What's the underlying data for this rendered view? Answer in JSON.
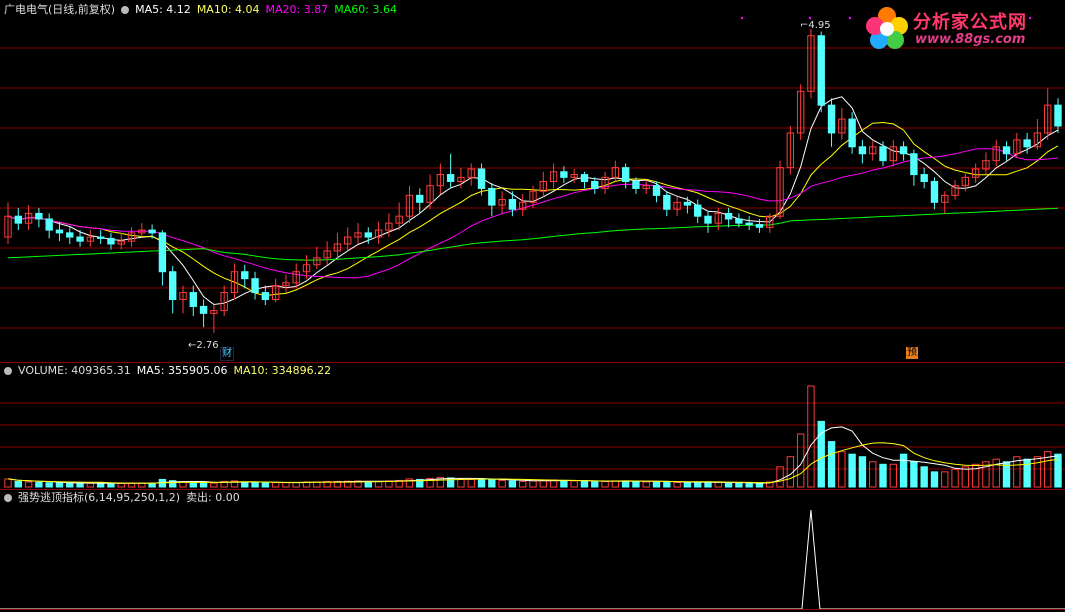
{
  "price_panel": {
    "title": "广电电气(日线,前复权)",
    "ma5": "MA5: 4.12",
    "ma10": "MA10: 4.04",
    "ma20": "MA20: 3.87",
    "ma60": "MA60: 3.64",
    "high_label": "4.95",
    "low_label": "2.76",
    "badge_cai": "财",
    "badge_yu": "预"
  },
  "volume_panel": {
    "volume": "VOLUME: 409365.31",
    "ma5": "MA5: 355905.06",
    "ma10": "MA10: 334896.22"
  },
  "indicator_panel": {
    "name": "强势逃顶指标(6,14,95,250,1,2)",
    "value": "卖出: 0.00"
  },
  "logo": {
    "text": "分析家公式网",
    "url": "www.88gs.com"
  },
  "colors": {
    "up": "#ff3b3b",
    "down": "#54ffff",
    "ma5": "#ffffff",
    "ma10": "#ffff00",
    "ma20": "#ff00ff",
    "ma60": "#00ff00",
    "grid": "#8b0000"
  },
  "chart_data": [
    {
      "type": "candlestick",
      "title": "广电电气(日线,前复权)",
      "y_marks": {
        "high": 4.95,
        "low": 2.76
      },
      "candles": [
        [
          3.45,
          3.6,
          3.7,
          3.4
        ],
        [
          3.6,
          3.55,
          3.66,
          3.5
        ],
        [
          3.55,
          3.62,
          3.68,
          3.5
        ],
        [
          3.62,
          3.58,
          3.66,
          3.52
        ],
        [
          3.58,
          3.5,
          3.62,
          3.44
        ],
        [
          3.5,
          3.48,
          3.56,
          3.42
        ],
        [
          3.48,
          3.45,
          3.52,
          3.4
        ],
        [
          3.45,
          3.42,
          3.5,
          3.38
        ],
        [
          3.42,
          3.45,
          3.5,
          3.38
        ],
        [
          3.45,
          3.44,
          3.5,
          3.4
        ],
        [
          3.44,
          3.4,
          3.48,
          3.36
        ],
        [
          3.4,
          3.42,
          3.48,
          3.36
        ],
        [
          3.42,
          3.48,
          3.52,
          3.38
        ],
        [
          3.48,
          3.5,
          3.55,
          3.45
        ],
        [
          3.5,
          3.48,
          3.54,
          3.44
        ],
        [
          3.48,
          3.2,
          3.5,
          3.1
        ],
        [
          3.2,
          3.0,
          3.24,
          2.9
        ],
        [
          3.0,
          3.05,
          3.1,
          2.9
        ],
        [
          3.05,
          2.95,
          3.1,
          2.88
        ],
        [
          2.95,
          2.9,
          3.0,
          2.8
        ],
        [
          2.9,
          2.92,
          2.96,
          2.76
        ],
        [
          2.92,
          3.05,
          3.1,
          2.88
        ],
        [
          3.05,
          3.2,
          3.26,
          3.0
        ],
        [
          3.2,
          3.15,
          3.25,
          3.08
        ],
        [
          3.15,
          3.05,
          3.2,
          3.0
        ],
        [
          3.05,
          3.0,
          3.1,
          2.96
        ],
        [
          3.0,
          3.1,
          3.15,
          2.98
        ],
        [
          3.1,
          3.12,
          3.18,
          3.05
        ],
        [
          3.12,
          3.2,
          3.26,
          3.08
        ],
        [
          3.2,
          3.25,
          3.32,
          3.15
        ],
        [
          3.25,
          3.3,
          3.38,
          3.22
        ],
        [
          3.3,
          3.35,
          3.42,
          3.25
        ],
        [
          3.35,
          3.4,
          3.48,
          3.3
        ],
        [
          3.4,
          3.45,
          3.52,
          3.35
        ],
        [
          3.45,
          3.48,
          3.55,
          3.4
        ],
        [
          3.48,
          3.45,
          3.52,
          3.4
        ],
        [
          3.45,
          3.5,
          3.56,
          3.4
        ],
        [
          3.5,
          3.55,
          3.62,
          3.45
        ],
        [
          3.55,
          3.6,
          3.7,
          3.5
        ],
        [
          3.6,
          3.75,
          3.82,
          3.55
        ],
        [
          3.75,
          3.7,
          3.8,
          3.62
        ],
        [
          3.7,
          3.82,
          3.9,
          3.65
        ],
        [
          3.82,
          3.9,
          3.98,
          3.76
        ],
        [
          3.9,
          3.85,
          4.05,
          3.8
        ],
        [
          3.85,
          3.88,
          3.95,
          3.8
        ],
        [
          3.88,
          3.94,
          3.98,
          3.82
        ],
        [
          3.94,
          3.8,
          3.98,
          3.75
        ],
        [
          3.8,
          3.68,
          3.84,
          3.6
        ],
        [
          3.68,
          3.72,
          3.78,
          3.62
        ],
        [
          3.72,
          3.65,
          3.78,
          3.6
        ],
        [
          3.65,
          3.7,
          3.76,
          3.6
        ],
        [
          3.7,
          3.78,
          3.82,
          3.66
        ],
        [
          3.78,
          3.85,
          3.92,
          3.74
        ],
        [
          3.85,
          3.92,
          3.98,
          3.8
        ],
        [
          3.92,
          3.88,
          3.96,
          3.84
        ],
        [
          3.88,
          3.9,
          3.94,
          3.84
        ],
        [
          3.9,
          3.85,
          3.92,
          3.8
        ],
        [
          3.85,
          3.8,
          3.88,
          3.76
        ],
        [
          3.8,
          3.88,
          3.92,
          3.76
        ],
        [
          3.88,
          3.95,
          4.0,
          3.85
        ],
        [
          3.95,
          3.85,
          3.98,
          3.8
        ],
        [
          3.85,
          3.8,
          3.88,
          3.76
        ],
        [
          3.8,
          3.82,
          3.86,
          3.76
        ],
        [
          3.82,
          3.75,
          3.85,
          3.7
        ],
        [
          3.75,
          3.65,
          3.78,
          3.6
        ],
        [
          3.65,
          3.7,
          3.74,
          3.6
        ],
        [
          3.7,
          3.68,
          3.74,
          3.62
        ],
        [
          3.68,
          3.6,
          3.72,
          3.55
        ],
        [
          3.6,
          3.55,
          3.64,
          3.48
        ],
        [
          3.55,
          3.62,
          3.66,
          3.5
        ],
        [
          3.62,
          3.58,
          3.66,
          3.52
        ],
        [
          3.58,
          3.55,
          3.62,
          3.52
        ],
        [
          3.55,
          3.54,
          3.6,
          3.5
        ],
        [
          3.54,
          3.52,
          3.58,
          3.48
        ],
        [
          3.52,
          3.6,
          3.62,
          3.48
        ],
        [
          3.6,
          3.95,
          4.0,
          3.58
        ],
        [
          3.95,
          4.2,
          4.25,
          3.9
        ],
        [
          4.2,
          4.5,
          4.55,
          4.15
        ],
        [
          4.5,
          4.9,
          4.95,
          4.45
        ],
        [
          4.9,
          4.4,
          4.93,
          4.35
        ],
        [
          4.4,
          4.2,
          4.45,
          4.1
        ],
        [
          4.2,
          4.3,
          4.38,
          4.15
        ],
        [
          4.3,
          4.1,
          4.35,
          4.05
        ],
        [
          4.1,
          4.05,
          4.15,
          3.98
        ],
        [
          4.05,
          4.1,
          4.14,
          4.0
        ],
        [
          4.1,
          4.0,
          4.14,
          3.96
        ],
        [
          4.0,
          4.1,
          4.15,
          3.96
        ],
        [
          4.1,
          4.05,
          4.14,
          4.0
        ],
        [
          4.05,
          3.9,
          4.08,
          3.82
        ],
        [
          3.9,
          3.85,
          3.95,
          3.8
        ],
        [
          3.85,
          3.7,
          3.88,
          3.65
        ],
        [
          3.7,
          3.75,
          3.78,
          3.62
        ],
        [
          3.75,
          3.82,
          3.86,
          3.72
        ],
        [
          3.82,
          3.88,
          3.92,
          3.78
        ],
        [
          3.88,
          3.94,
          3.98,
          3.84
        ],
        [
          3.94,
          4.0,
          4.06,
          3.9
        ],
        [
          4.0,
          4.1,
          4.15,
          3.96
        ],
        [
          4.1,
          4.05,
          4.14,
          4.0
        ],
        [
          4.05,
          4.15,
          4.2,
          4.02
        ],
        [
          4.15,
          4.1,
          4.2,
          4.05
        ],
        [
          4.1,
          4.2,
          4.3,
          4.08
        ],
        [
          4.2,
          4.4,
          4.52,
          4.15
        ],
        [
          4.4,
          4.25,
          4.45,
          4.2
        ]
      ],
      "ma": {
        "ma5": 4.12,
        "ma10": 4.04,
        "ma20": 3.87,
        "ma60": 3.64
      }
    },
    {
      "type": "bar",
      "title": "VOLUME",
      "volumes": [
        0.32,
        0.22,
        0.2,
        0.18,
        0.17,
        0.16,
        0.15,
        0.14,
        0.15,
        0.16,
        0.15,
        0.14,
        0.15,
        0.16,
        0.15,
        0.3,
        0.25,
        0.2,
        0.18,
        0.16,
        0.15,
        0.22,
        0.24,
        0.2,
        0.18,
        0.16,
        0.18,
        0.17,
        0.18,
        0.2,
        0.2,
        0.22,
        0.22,
        0.23,
        0.24,
        0.22,
        0.22,
        0.24,
        0.26,
        0.32,
        0.3,
        0.34,
        0.38,
        0.36,
        0.32,
        0.3,
        0.32,
        0.28,
        0.26,
        0.24,
        0.22,
        0.24,
        0.26,
        0.28,
        0.26,
        0.24,
        0.22,
        0.2,
        0.22,
        0.24,
        0.24,
        0.22,
        0.2,
        0.22,
        0.22,
        0.18,
        0.16,
        0.2,
        0.2,
        0.18,
        0.16,
        0.15,
        0.14,
        0.14,
        0.2,
        0.8,
        1.2,
        2.1,
        4.0,
        2.6,
        1.8,
        1.4,
        1.3,
        1.2,
        1.0,
        0.9,
        0.9,
        1.3,
        1.0,
        0.8,
        0.6,
        0.6,
        0.7,
        0.8,
        0.9,
        1.0,
        1.1,
        1.0,
        1.2,
        1.1,
        1.2,
        1.4,
        1.3
      ],
      "ma": {
        "ma5": 355905.06,
        "ma10": 334896.22
      },
      "volume_last": 409365.31
    },
    {
      "type": "line",
      "title": "强势逃顶指标(6,14,95,250,1,2)",
      "values_signal_index": 78
    }
  ]
}
